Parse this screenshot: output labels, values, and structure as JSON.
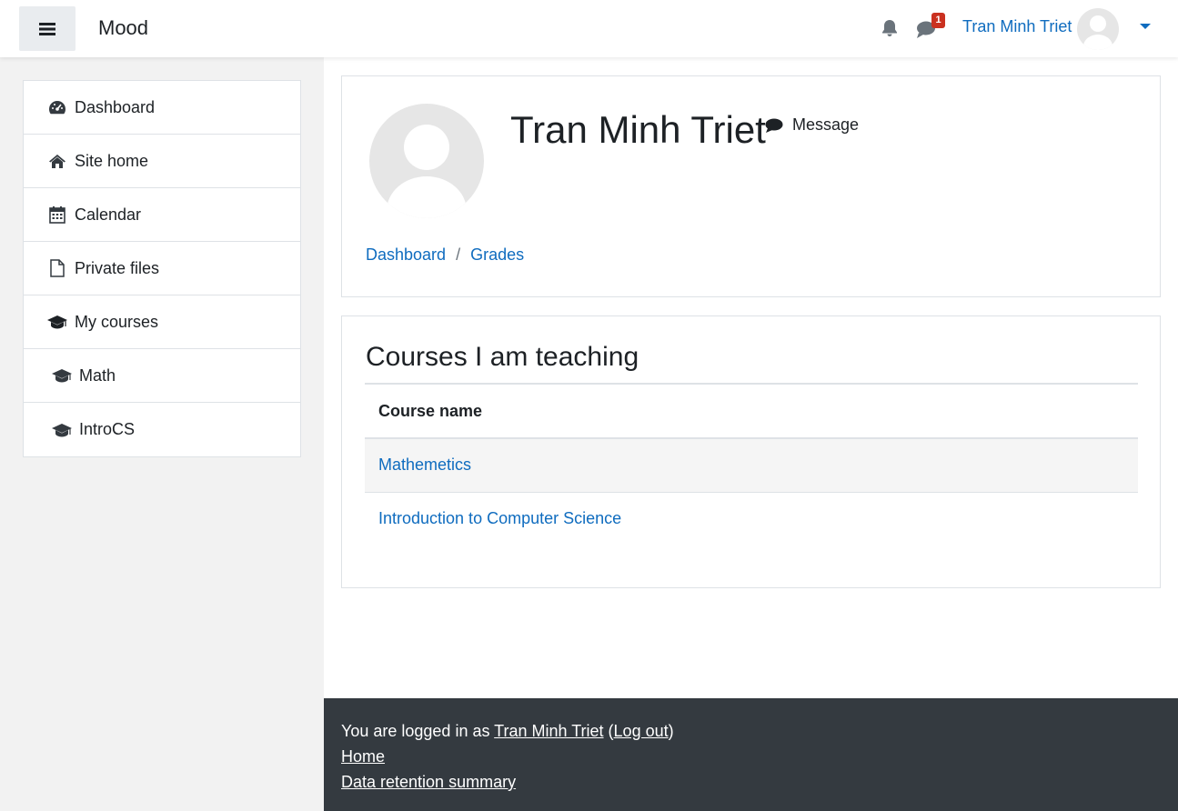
{
  "navbar": {
    "brand": "Mood",
    "notification_count": "1",
    "user_name": "Tran Minh Triet"
  },
  "sidebar": {
    "items": [
      {
        "label": "Dashboard",
        "icon": "dashboard-icon"
      },
      {
        "label": "Site home",
        "icon": "home-icon"
      },
      {
        "label": "Calendar",
        "icon": "calendar-icon"
      },
      {
        "label": "Private files",
        "icon": "file-icon"
      },
      {
        "label": "My courses",
        "icon": "graduation-cap-icon"
      },
      {
        "label": "Math",
        "icon": "graduation-cap-icon"
      },
      {
        "label": "IntroCS",
        "icon": "graduation-cap-icon"
      }
    ]
  },
  "header": {
    "title": "Tran Minh Triet",
    "message_label": "Message",
    "breadcrumb": [
      "Dashboard",
      "Grades"
    ],
    "breadcrumb_separator": "/"
  },
  "courses": {
    "title": "Courses I am teaching",
    "column_header": "Course name",
    "rows": [
      "Mathemetics",
      "Introduction to Computer Science"
    ]
  },
  "footer": {
    "logged_in_prefix": "You are logged in as",
    "user_link": "Tran Minh Triet",
    "logout_open": "(",
    "logout_label": "Log out",
    "logout_close": ")",
    "home_link": "Home",
    "data_retention_link": "Data retention summary"
  },
  "colors": {
    "link": "#0f6cbf",
    "footer_bg": "#343a40",
    "badge": "#ca3120"
  }
}
